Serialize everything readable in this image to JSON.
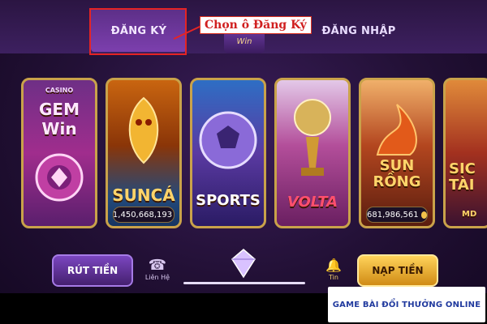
{
  "tabs": {
    "register": "ĐĂNG KÝ",
    "login": "ĐĂNG NHẬP"
  },
  "callout": "Chọn ô Đăng Ký",
  "logo": "Win",
  "cards": [
    {
      "label": "GEM Win",
      "small": "CASINO"
    },
    {
      "label": "SUNCÁ",
      "jackpot": "1,450,668,193"
    },
    {
      "label": "SPORTS"
    },
    {
      "label": "VOLTA"
    },
    {
      "label": "SUN RỒNG",
      "jackpot": "681,986,561"
    },
    {
      "label": "SIC TÀI",
      "small": "MD"
    }
  ],
  "bottom": {
    "withdraw": "RÚT TIỀN",
    "contact": "Liên Hệ",
    "deposit": "NẠP TIỀN",
    "notif": "Tin"
  },
  "brand": "GAME BÀI ĐỔI THƯỞNG ONLINE"
}
